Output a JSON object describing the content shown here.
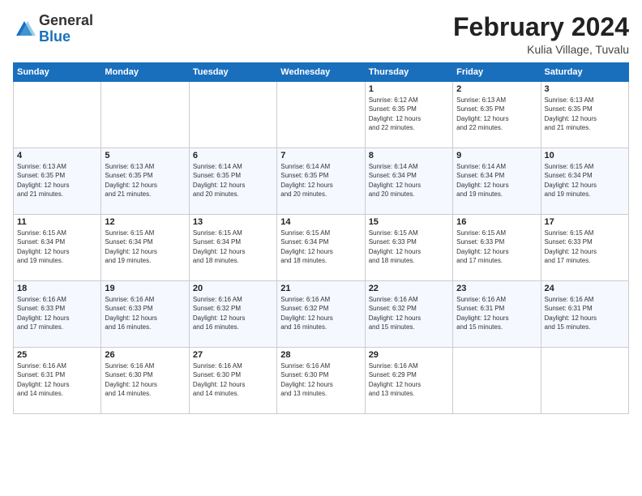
{
  "header": {
    "logo_general": "General",
    "logo_blue": "Blue",
    "month_title": "February 2024",
    "location": "Kulia Village, Tuvalu"
  },
  "days_of_week": [
    "Sunday",
    "Monday",
    "Tuesday",
    "Wednesday",
    "Thursday",
    "Friday",
    "Saturday"
  ],
  "weeks": [
    [
      {
        "day": "",
        "info": ""
      },
      {
        "day": "",
        "info": ""
      },
      {
        "day": "",
        "info": ""
      },
      {
        "day": "",
        "info": ""
      },
      {
        "day": "1",
        "info": "Sunrise: 6:12 AM\nSunset: 6:35 PM\nDaylight: 12 hours\nand 22 minutes."
      },
      {
        "day": "2",
        "info": "Sunrise: 6:13 AM\nSunset: 6:35 PM\nDaylight: 12 hours\nand 22 minutes."
      },
      {
        "day": "3",
        "info": "Sunrise: 6:13 AM\nSunset: 6:35 PM\nDaylight: 12 hours\nand 21 minutes."
      }
    ],
    [
      {
        "day": "4",
        "info": "Sunrise: 6:13 AM\nSunset: 6:35 PM\nDaylight: 12 hours\nand 21 minutes."
      },
      {
        "day": "5",
        "info": "Sunrise: 6:13 AM\nSunset: 6:35 PM\nDaylight: 12 hours\nand 21 minutes."
      },
      {
        "day": "6",
        "info": "Sunrise: 6:14 AM\nSunset: 6:35 PM\nDaylight: 12 hours\nand 20 minutes."
      },
      {
        "day": "7",
        "info": "Sunrise: 6:14 AM\nSunset: 6:35 PM\nDaylight: 12 hours\nand 20 minutes."
      },
      {
        "day": "8",
        "info": "Sunrise: 6:14 AM\nSunset: 6:34 PM\nDaylight: 12 hours\nand 20 minutes."
      },
      {
        "day": "9",
        "info": "Sunrise: 6:14 AM\nSunset: 6:34 PM\nDaylight: 12 hours\nand 19 minutes."
      },
      {
        "day": "10",
        "info": "Sunrise: 6:15 AM\nSunset: 6:34 PM\nDaylight: 12 hours\nand 19 minutes."
      }
    ],
    [
      {
        "day": "11",
        "info": "Sunrise: 6:15 AM\nSunset: 6:34 PM\nDaylight: 12 hours\nand 19 minutes."
      },
      {
        "day": "12",
        "info": "Sunrise: 6:15 AM\nSunset: 6:34 PM\nDaylight: 12 hours\nand 19 minutes."
      },
      {
        "day": "13",
        "info": "Sunrise: 6:15 AM\nSunset: 6:34 PM\nDaylight: 12 hours\nand 18 minutes."
      },
      {
        "day": "14",
        "info": "Sunrise: 6:15 AM\nSunset: 6:34 PM\nDaylight: 12 hours\nand 18 minutes."
      },
      {
        "day": "15",
        "info": "Sunrise: 6:15 AM\nSunset: 6:33 PM\nDaylight: 12 hours\nand 18 minutes."
      },
      {
        "day": "16",
        "info": "Sunrise: 6:15 AM\nSunset: 6:33 PM\nDaylight: 12 hours\nand 17 minutes."
      },
      {
        "day": "17",
        "info": "Sunrise: 6:15 AM\nSunset: 6:33 PM\nDaylight: 12 hours\nand 17 minutes."
      }
    ],
    [
      {
        "day": "18",
        "info": "Sunrise: 6:16 AM\nSunset: 6:33 PM\nDaylight: 12 hours\nand 17 minutes."
      },
      {
        "day": "19",
        "info": "Sunrise: 6:16 AM\nSunset: 6:33 PM\nDaylight: 12 hours\nand 16 minutes."
      },
      {
        "day": "20",
        "info": "Sunrise: 6:16 AM\nSunset: 6:32 PM\nDaylight: 12 hours\nand 16 minutes."
      },
      {
        "day": "21",
        "info": "Sunrise: 6:16 AM\nSunset: 6:32 PM\nDaylight: 12 hours\nand 16 minutes."
      },
      {
        "day": "22",
        "info": "Sunrise: 6:16 AM\nSunset: 6:32 PM\nDaylight: 12 hours\nand 15 minutes."
      },
      {
        "day": "23",
        "info": "Sunrise: 6:16 AM\nSunset: 6:31 PM\nDaylight: 12 hours\nand 15 minutes."
      },
      {
        "day": "24",
        "info": "Sunrise: 6:16 AM\nSunset: 6:31 PM\nDaylight: 12 hours\nand 15 minutes."
      }
    ],
    [
      {
        "day": "25",
        "info": "Sunrise: 6:16 AM\nSunset: 6:31 PM\nDaylight: 12 hours\nand 14 minutes."
      },
      {
        "day": "26",
        "info": "Sunrise: 6:16 AM\nSunset: 6:30 PM\nDaylight: 12 hours\nand 14 minutes."
      },
      {
        "day": "27",
        "info": "Sunrise: 6:16 AM\nSunset: 6:30 PM\nDaylight: 12 hours\nand 14 minutes."
      },
      {
        "day": "28",
        "info": "Sunrise: 6:16 AM\nSunset: 6:30 PM\nDaylight: 12 hours\nand 13 minutes."
      },
      {
        "day": "29",
        "info": "Sunrise: 6:16 AM\nSunset: 6:29 PM\nDaylight: 12 hours\nand 13 minutes."
      },
      {
        "day": "",
        "info": ""
      },
      {
        "day": "",
        "info": ""
      }
    ]
  ]
}
